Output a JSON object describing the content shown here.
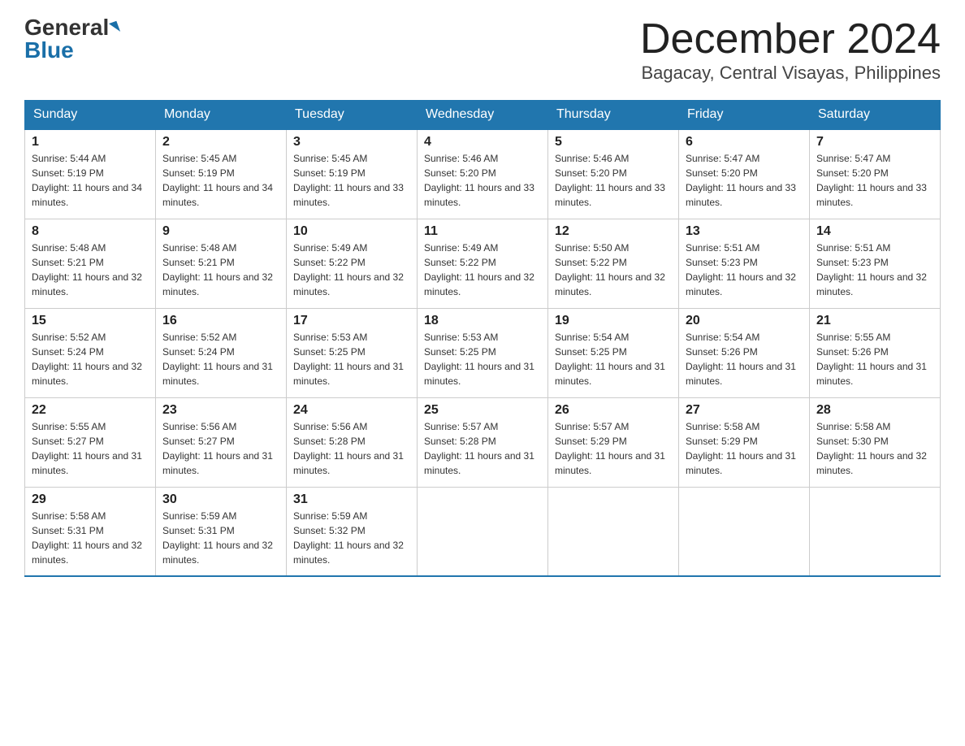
{
  "header": {
    "logo_general": "General",
    "logo_blue": "Blue",
    "month_year": "December 2024",
    "location": "Bagacay, Central Visayas, Philippines"
  },
  "days_of_week": [
    "Sunday",
    "Monday",
    "Tuesday",
    "Wednesday",
    "Thursday",
    "Friday",
    "Saturday"
  ],
  "weeks": [
    [
      {
        "day": "1",
        "sunrise": "5:44 AM",
        "sunset": "5:19 PM",
        "daylight": "11 hours and 34 minutes."
      },
      {
        "day": "2",
        "sunrise": "5:45 AM",
        "sunset": "5:19 PM",
        "daylight": "11 hours and 34 minutes."
      },
      {
        "day": "3",
        "sunrise": "5:45 AM",
        "sunset": "5:19 PM",
        "daylight": "11 hours and 33 minutes."
      },
      {
        "day": "4",
        "sunrise": "5:46 AM",
        "sunset": "5:20 PM",
        "daylight": "11 hours and 33 minutes."
      },
      {
        "day": "5",
        "sunrise": "5:46 AM",
        "sunset": "5:20 PM",
        "daylight": "11 hours and 33 minutes."
      },
      {
        "day": "6",
        "sunrise": "5:47 AM",
        "sunset": "5:20 PM",
        "daylight": "11 hours and 33 minutes."
      },
      {
        "day": "7",
        "sunrise": "5:47 AM",
        "sunset": "5:20 PM",
        "daylight": "11 hours and 33 minutes."
      }
    ],
    [
      {
        "day": "8",
        "sunrise": "5:48 AM",
        "sunset": "5:21 PM",
        "daylight": "11 hours and 32 minutes."
      },
      {
        "day": "9",
        "sunrise": "5:48 AM",
        "sunset": "5:21 PM",
        "daylight": "11 hours and 32 minutes."
      },
      {
        "day": "10",
        "sunrise": "5:49 AM",
        "sunset": "5:22 PM",
        "daylight": "11 hours and 32 minutes."
      },
      {
        "day": "11",
        "sunrise": "5:49 AM",
        "sunset": "5:22 PM",
        "daylight": "11 hours and 32 minutes."
      },
      {
        "day": "12",
        "sunrise": "5:50 AM",
        "sunset": "5:22 PM",
        "daylight": "11 hours and 32 minutes."
      },
      {
        "day": "13",
        "sunrise": "5:51 AM",
        "sunset": "5:23 PM",
        "daylight": "11 hours and 32 minutes."
      },
      {
        "day": "14",
        "sunrise": "5:51 AM",
        "sunset": "5:23 PM",
        "daylight": "11 hours and 32 minutes."
      }
    ],
    [
      {
        "day": "15",
        "sunrise": "5:52 AM",
        "sunset": "5:24 PM",
        "daylight": "11 hours and 32 minutes."
      },
      {
        "day": "16",
        "sunrise": "5:52 AM",
        "sunset": "5:24 PM",
        "daylight": "11 hours and 31 minutes."
      },
      {
        "day": "17",
        "sunrise": "5:53 AM",
        "sunset": "5:25 PM",
        "daylight": "11 hours and 31 minutes."
      },
      {
        "day": "18",
        "sunrise": "5:53 AM",
        "sunset": "5:25 PM",
        "daylight": "11 hours and 31 minutes."
      },
      {
        "day": "19",
        "sunrise": "5:54 AM",
        "sunset": "5:25 PM",
        "daylight": "11 hours and 31 minutes."
      },
      {
        "day": "20",
        "sunrise": "5:54 AM",
        "sunset": "5:26 PM",
        "daylight": "11 hours and 31 minutes."
      },
      {
        "day": "21",
        "sunrise": "5:55 AM",
        "sunset": "5:26 PM",
        "daylight": "11 hours and 31 minutes."
      }
    ],
    [
      {
        "day": "22",
        "sunrise": "5:55 AM",
        "sunset": "5:27 PM",
        "daylight": "11 hours and 31 minutes."
      },
      {
        "day": "23",
        "sunrise": "5:56 AM",
        "sunset": "5:27 PM",
        "daylight": "11 hours and 31 minutes."
      },
      {
        "day": "24",
        "sunrise": "5:56 AM",
        "sunset": "5:28 PM",
        "daylight": "11 hours and 31 minutes."
      },
      {
        "day": "25",
        "sunrise": "5:57 AM",
        "sunset": "5:28 PM",
        "daylight": "11 hours and 31 minutes."
      },
      {
        "day": "26",
        "sunrise": "5:57 AM",
        "sunset": "5:29 PM",
        "daylight": "11 hours and 31 minutes."
      },
      {
        "day": "27",
        "sunrise": "5:58 AM",
        "sunset": "5:29 PM",
        "daylight": "11 hours and 31 minutes."
      },
      {
        "day": "28",
        "sunrise": "5:58 AM",
        "sunset": "5:30 PM",
        "daylight": "11 hours and 32 minutes."
      }
    ],
    [
      {
        "day": "29",
        "sunrise": "5:58 AM",
        "sunset": "5:31 PM",
        "daylight": "11 hours and 32 minutes."
      },
      {
        "day": "30",
        "sunrise": "5:59 AM",
        "sunset": "5:31 PM",
        "daylight": "11 hours and 32 minutes."
      },
      {
        "day": "31",
        "sunrise": "5:59 AM",
        "sunset": "5:32 PM",
        "daylight": "11 hours and 32 minutes."
      },
      null,
      null,
      null,
      null
    ]
  ]
}
